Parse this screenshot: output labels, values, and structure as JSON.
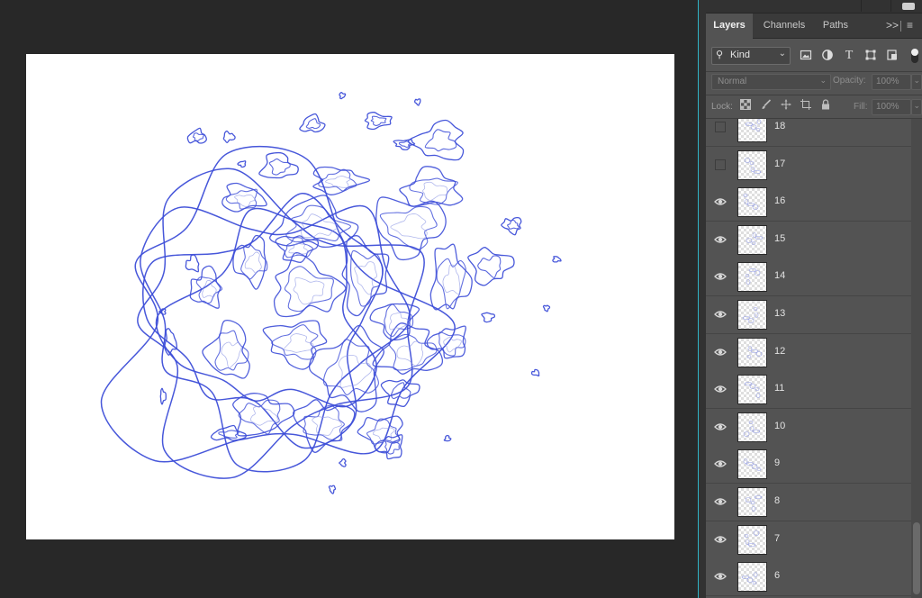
{
  "panel": {
    "tabs": [
      {
        "label": "Layers",
        "active": true
      },
      {
        "label": "Channels",
        "active": false
      },
      {
        "label": "Paths",
        "active": false
      }
    ],
    "overflow_icon": "double-chevron-right-icon",
    "menu_icon": "hamburger-menu-icon"
  },
  "filter": {
    "kind_label": "Kind",
    "icons": [
      "image-filter-icon",
      "adjustment-filter-icon",
      "type-filter-icon",
      "shape-filter-icon",
      "smart-object-filter-icon"
    ]
  },
  "blend": {
    "mode": "Normal",
    "opacity_label": "Opacity:",
    "opacity_value": "100%"
  },
  "lock": {
    "label": "Lock:",
    "icons": [
      "lock-transparent-icon",
      "lock-pixels-icon",
      "lock-position-icon",
      "lock-artboard-icon",
      "lock-all-icon"
    ],
    "fill_label": "Fill:",
    "fill_value": "100%"
  },
  "layers": [
    {
      "name": "18",
      "visible": false
    },
    {
      "name": "17",
      "visible": false
    },
    {
      "name": "16",
      "visible": true
    },
    {
      "name": "15",
      "visible": true
    },
    {
      "name": "14",
      "visible": true
    },
    {
      "name": "13",
      "visible": true
    },
    {
      "name": "12",
      "visible": true
    },
    {
      "name": "11",
      "visible": true
    },
    {
      "name": "10",
      "visible": true
    },
    {
      "name": "9",
      "visible": true
    },
    {
      "name": "8",
      "visible": true
    },
    {
      "name": "7",
      "visible": true
    },
    {
      "name": "6",
      "visible": true
    }
  ],
  "colors": {
    "stroke": "#3d4ed8",
    "stroke_light": "#8f99e6",
    "panel_bg": "#535353",
    "workspace_bg": "#282828",
    "accent_line": "#2fb3c6"
  }
}
